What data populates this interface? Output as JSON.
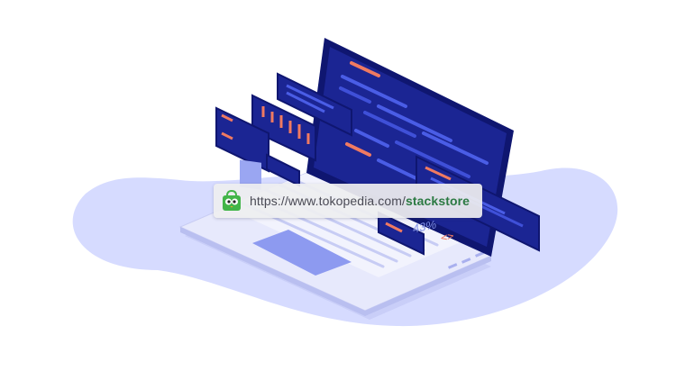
{
  "url_bar": {
    "prefix": "https://www.tokopedia.com/",
    "path": "stackstore"
  },
  "progress": {
    "label": "43%"
  },
  "code_glyph": "<>",
  "colors": {
    "blob": "#d6dbff",
    "laptop_body": "#e3e6fb",
    "screen_dark": "#1b2593",
    "code_accent": "#f07a61",
    "code_line": "#4a5de6",
    "shop_green": "#42b549"
  },
  "icons": [
    "shop-bag-icon"
  ]
}
